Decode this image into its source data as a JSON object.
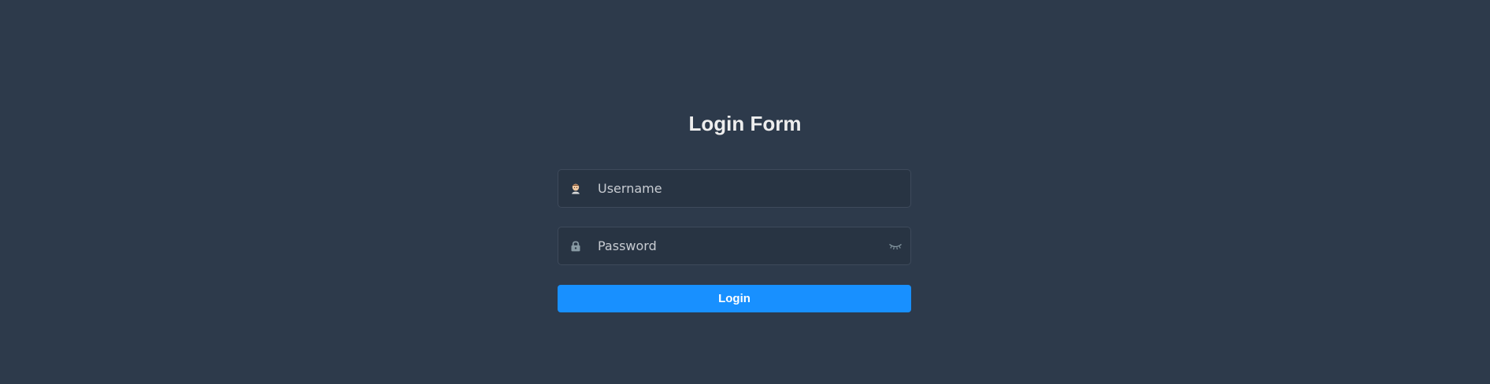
{
  "form": {
    "title": "Login Form",
    "username": {
      "placeholder": "Username",
      "value": "",
      "icon": "user-avatar-icon"
    },
    "password": {
      "placeholder": "Password",
      "value": "",
      "icon": "lock-icon",
      "toggle_icon": "eye-closed-icon"
    },
    "submit_label": "Login"
  },
  "colors": {
    "background": "#2d3a4b",
    "field_background": "#283443",
    "field_border": "#3e4a5b",
    "accent": "#1890ff",
    "title": "#eeeeee"
  }
}
